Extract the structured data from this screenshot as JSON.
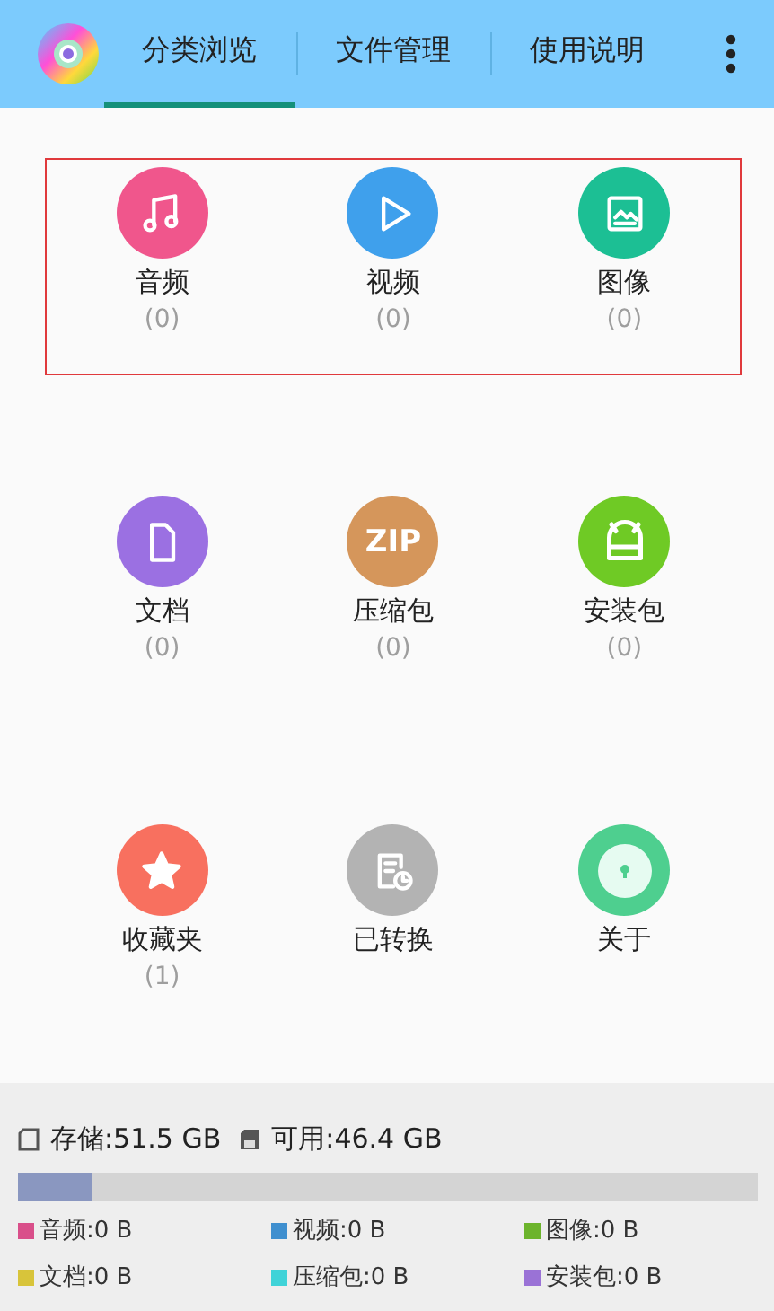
{
  "tabs": [
    {
      "label": "分类浏览",
      "selected": true
    },
    {
      "label": "文件管理",
      "selected": false
    },
    {
      "label": "使用说明",
      "selected": false
    }
  ],
  "category_rows": [
    {
      "highlighted": true,
      "items": [
        {
          "kind": "audio",
          "label": "音频",
          "count": "(0)",
          "color": "#f0568c"
        },
        {
          "kind": "video",
          "label": "视频",
          "count": "(0)",
          "color": "#3fa0ec"
        },
        {
          "kind": "image",
          "label": "图像",
          "count": "(0)",
          "color": "#1cbf94"
        }
      ]
    },
    {
      "highlighted": false,
      "items": [
        {
          "kind": "document",
          "label": "文档",
          "count": "(0)",
          "color": "#9b70e2"
        },
        {
          "kind": "zip",
          "label": "压缩包",
          "count": "(0)",
          "color": "#d5965b",
          "glyph": "ZIP"
        },
        {
          "kind": "package",
          "label": "安装包",
          "count": "(0)",
          "color": "#6fca25"
        }
      ]
    },
    {
      "highlighted": false,
      "items": [
        {
          "kind": "favorite",
          "label": "收藏夹",
          "count": "(1)",
          "color": "#f8705f"
        },
        {
          "kind": "converted",
          "label": "已转换",
          "color": "#b3b3b3"
        },
        {
          "kind": "about",
          "label": "关于",
          "color": "#4ecf8f"
        }
      ]
    }
  ],
  "storage": {
    "total": "存储:51.5 GB",
    "free": "可用:46.4 GB",
    "level": 0.1,
    "legend": [
      {
        "label": "音频:0 B",
        "color": "#d94f8a"
      },
      {
        "label": "视频:0 B",
        "color": "#3f8fcf"
      },
      {
        "label": "图像:0 B",
        "color": "#6cb42c"
      },
      {
        "label": "文档:0 B",
        "color": "#d8c43a"
      },
      {
        "label": "压缩包:0 B",
        "color": "#3fd3d8"
      },
      {
        "label": "安装包:0 B",
        "color": "#9a72d6"
      }
    ]
  }
}
